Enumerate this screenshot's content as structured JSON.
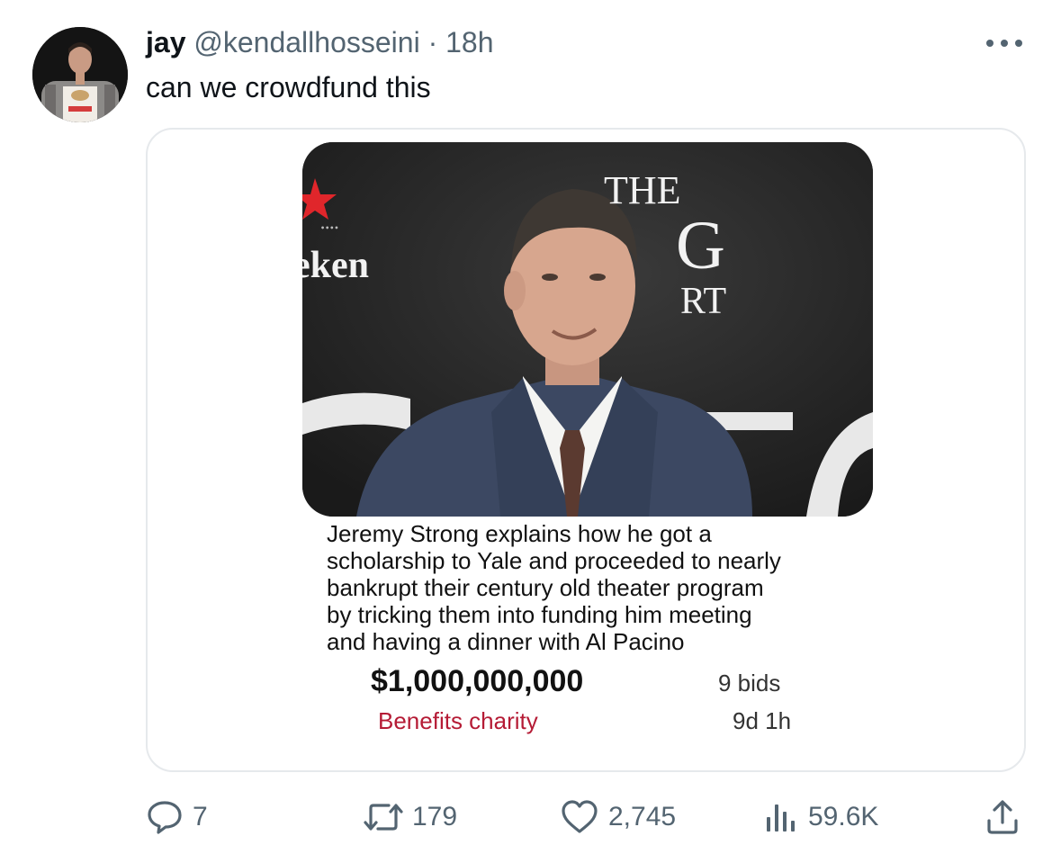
{
  "tweet": {
    "display_name": "jay",
    "handle": "@kendallhosseini",
    "separator": "·",
    "time": "18h",
    "text": "can we crowdfund this"
  },
  "card": {
    "photo_sign_text": {
      "brand": "eken",
      "the": "THE",
      "g": "G",
      "rt": "RT"
    },
    "listing_title": "Jeremy Strong explains how he got a\nscholarship to Yale and proceeded to nearly\nbankrupt their century old theater program\nby tricking them into funding him meeting\nand having a dinner with Al Pacino",
    "price": "$1,000,000,000",
    "benefit": "Benefits charity",
    "bids": "9 bids",
    "time_left": "9d 1h"
  },
  "actions": {
    "replies": "7",
    "reposts": "179",
    "likes": "2,745",
    "views": "59.6K"
  },
  "icons": {
    "more": "more-horizontal-icon",
    "reply": "reply-bubble-icon",
    "repost": "repost-arrows-icon",
    "like": "heart-icon",
    "views": "analytics-bars-icon",
    "share": "share-upload-icon"
  },
  "colors": {
    "secondary_text": "#536471",
    "charity_red": "#b51b35",
    "border": "#e6e9ec"
  }
}
